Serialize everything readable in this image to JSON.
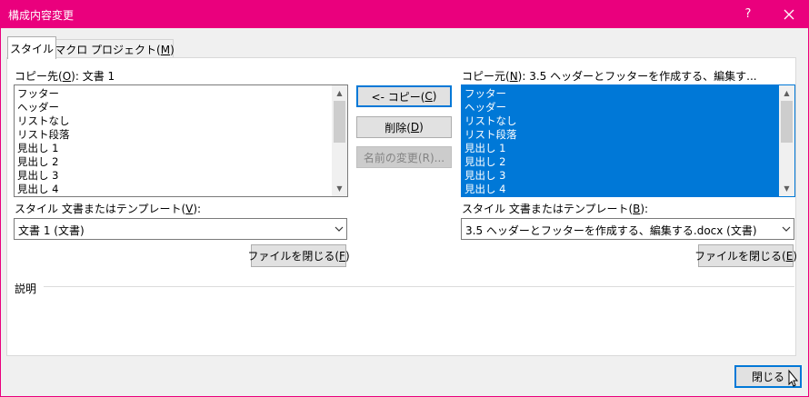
{
  "window": {
    "title": "構成内容変更",
    "help_label": "?",
    "colors": {
      "titlebar": "#ea007d",
      "selection": "#0078d7"
    }
  },
  "tabs": [
    {
      "label": "スタイル"
    },
    {
      "label_pre": "マクロ プロジェクト(",
      "label_key": "M",
      "label_post": ")"
    }
  ],
  "left": {
    "label_pre": "コピー先(",
    "label_key": "O",
    "label_post": "):",
    "document": "文書 1",
    "items": [
      "フッター",
      "ヘッダー",
      "リストなし",
      "リスト段落",
      "見出し 1",
      "見出し 2",
      "見出し 3",
      "見出し 4"
    ],
    "source_label_pre": "スタイル 文書またはテンプレート(",
    "source_label_key": "V",
    "source_label_post": "):",
    "source_value": "文書 1 (文書)",
    "close_pre": "ファイルを閉じる(",
    "close_key": "F",
    "close_post": ")"
  },
  "middle": {
    "copy_pre": "<- コピー(",
    "copy_key": "C",
    "copy_post": ")",
    "delete_pre": "削除(",
    "delete_key": "D",
    "delete_post": ")",
    "rename_label": "名前の変更(R)..."
  },
  "right": {
    "label_pre": "コピー元(",
    "label_key": "N",
    "label_post": "):",
    "document": "3.5 ヘッダーとフッターを作成する、編集す...",
    "items": [
      "フッター",
      "ヘッダー",
      "リストなし",
      "リスト段落",
      "見出し 1",
      "見出し 2",
      "見出し 3",
      "見出し 4"
    ],
    "source_label_pre": "スタイル 文書またはテンプレート(",
    "source_label_key": "B",
    "source_label_post": "):",
    "source_value": "3.5 ヘッダーとフッターを作成する、編集する.docx (文書)",
    "close_pre": "ファイルを閉じる(",
    "close_key": "E",
    "close_post": ")"
  },
  "description_label": "説明",
  "close_button": "閉じる"
}
